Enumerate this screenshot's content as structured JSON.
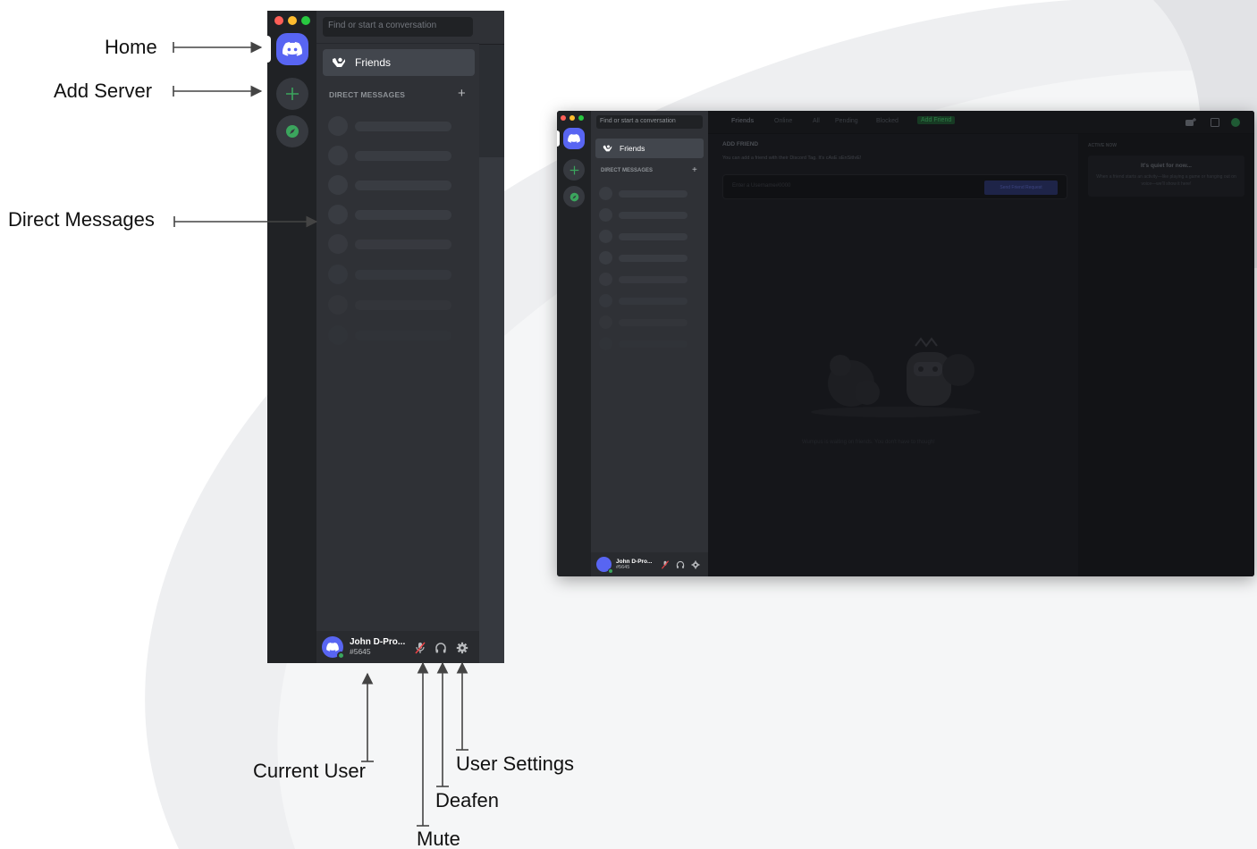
{
  "annotations": {
    "home": "Home",
    "add_server": "Add Server",
    "direct_messages": "Direct Messages",
    "current_user": "Current User",
    "mute": "Mute",
    "deafen": "Deafen",
    "user_settings": "User Settings"
  },
  "zoomed_window": {
    "search_placeholder": "Find or start a conversation",
    "friends_label": "Friends",
    "dm_header": "DIRECT MESSAGES",
    "dm_add": "+",
    "user": {
      "name": "John D-Pro...",
      "tag": "#5645",
      "status_color": "#3ba55d"
    }
  },
  "full_window": {
    "search_placeholder": "Find or start a conversation",
    "friends_label": "Friends",
    "dm_header": "DIRECT MESSAGES",
    "dm_add": "+",
    "tabs": [
      "Friends",
      "Online",
      "All",
      "Pending",
      "Blocked",
      "Add Friend"
    ],
    "add_friend_heading": "ADD FRIEND",
    "add_friend_desc": "You can add a friend with their Discord Tag. It's cAsE sEnSitIvE!",
    "add_friend_placeholder": "Enter a Username#0000",
    "send_request": "Send Friend Request",
    "active_now_heading": "ACTIVE NOW",
    "active_title": "It's quiet for now...",
    "active_desc": "When a friend starts an activity—like playing a game or hanging out on voice—we'll show it here!",
    "empty_state": "Wumpus is waiting on friends. You don't have to though!",
    "user": {
      "name": "John D-Pro...",
      "tag": "#5645"
    }
  },
  "colors": {
    "blurple": "#5865f2",
    "online_green": "#3ba55d",
    "add_green": "#3ba55d",
    "mute_red": "#ed4245"
  }
}
